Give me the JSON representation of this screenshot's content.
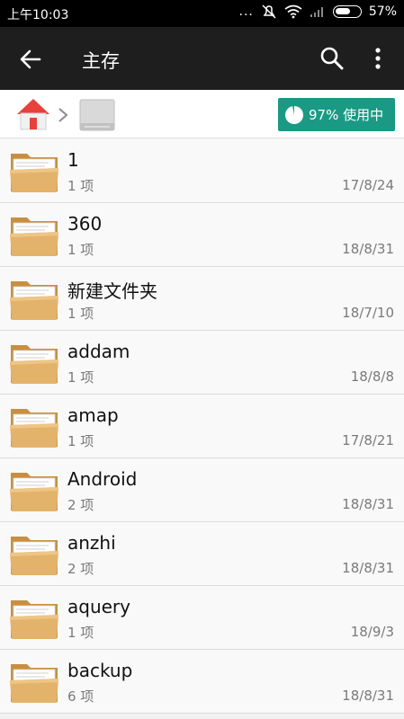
{
  "status_bar": {
    "time": "上午10:03",
    "signal_dots": "...",
    "battery_percent": "57%"
  },
  "toolbar": {
    "title": "主存",
    "back_icon": "arrow-left-icon",
    "search_icon": "search-icon",
    "more_icon": "more-vertical-icon"
  },
  "breadcrumb": {
    "home_icon": "home-icon",
    "drive_icon": "storage-drive-icon",
    "usage_label": "97% 使用中",
    "usage_fraction": 0.97
  },
  "colors": {
    "accent": "#1a9a84",
    "toolbar_bg": "#1e1e1e",
    "home_roof": "#e8403a",
    "folder": "#e3b36b"
  },
  "files": [
    {
      "name": "1",
      "count": "1 项",
      "date": "17/8/24"
    },
    {
      "name": "360",
      "count": "1 项",
      "date": "18/8/31"
    },
    {
      "name": "新建文件夹",
      "count": "1 项",
      "date": "18/7/10"
    },
    {
      "name": "addam",
      "count": "1 项",
      "date": "18/8/8"
    },
    {
      "name": "amap",
      "count": "1 项",
      "date": "17/8/21"
    },
    {
      "name": "Android",
      "count": "2 项",
      "date": "18/8/31"
    },
    {
      "name": "anzhi",
      "count": "2 项",
      "date": "18/8/31"
    },
    {
      "name": "aquery",
      "count": "1 项",
      "date": "18/9/3"
    },
    {
      "name": "backup",
      "count": "6 项",
      "date": "18/8/31"
    }
  ]
}
